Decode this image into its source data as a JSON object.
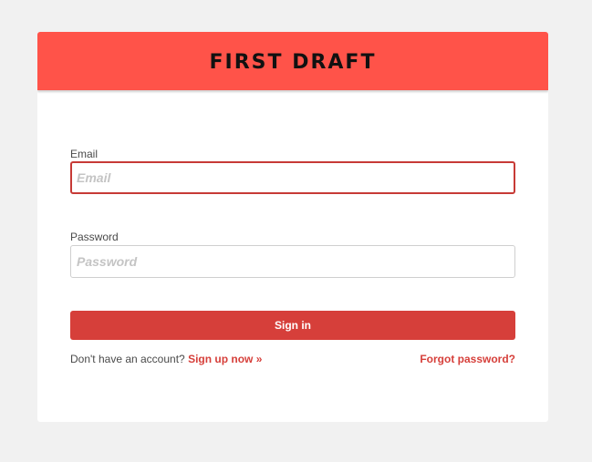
{
  "header": {
    "brand": "FIRST DRAFT"
  },
  "form": {
    "email_label": "Email",
    "email_placeholder": "Email",
    "email_value": "",
    "password_label": "Password",
    "password_placeholder": "Password",
    "password_value": "",
    "signin_label": "Sign in"
  },
  "footer": {
    "no_account_text": "Don't have an account?",
    "signup_link": "Sign up now »",
    "forgot_link": "Forgot password?"
  },
  "colors": {
    "page_background": "#f1f1f1",
    "header_background": "#ff5349",
    "accent": "#d63f3a",
    "focus_border": "#c73a36"
  }
}
